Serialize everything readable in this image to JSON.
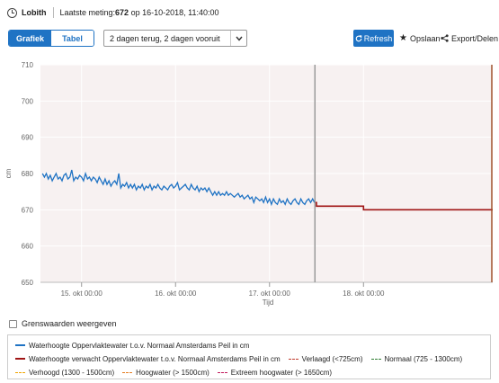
{
  "header": {
    "station": "Lobith",
    "meting_label": "Laatste meting:",
    "meting_value": "672",
    "meting_suffix": " op 16-10-2018, 11:40:00"
  },
  "toolbar": {
    "tab_grafiek": "Grafiek",
    "tab_tabel": "Tabel",
    "range_select": "2 dagen terug, 2 dagen vooruit",
    "refresh": "Refresh",
    "save": "Opslaan",
    "export": "Export/Delen"
  },
  "colors": {
    "accent": "#1f73c4",
    "measured": "#1f73c4",
    "forecast": "#a01515",
    "plot_bg": "#f7f1f1",
    "now_line": "#999999"
  },
  "chart_data": {
    "type": "line",
    "xlabel": "Tijd",
    "ylabel": "cm",
    "ylim": [
      650,
      710
    ],
    "yticks": [
      650,
      660,
      670,
      680,
      690,
      700,
      710
    ],
    "xticks": [
      "15. okt 00:00",
      "16. okt 00:00",
      "17. okt 00:00",
      "18. okt 00:00"
    ],
    "x_range_hours": [
      -10.5,
      105
    ],
    "now_hours": 59.6,
    "series": [
      {
        "name": "Waterhoogte Oppervlaktewater t.o.v. Normaal Amsterdams Peil in cm",
        "color": "#1f73c4",
        "x": [
          -10,
          -9.5,
          -9,
          -8.5,
          -8,
          -7.5,
          -7,
          -6.5,
          -6,
          -5.5,
          -5,
          -4.5,
          -4,
          -3.5,
          -3,
          -2.5,
          -2,
          -1.5,
          -1,
          -0.5,
          0,
          0.5,
          1,
          1.5,
          2,
          2.5,
          3,
          3.5,
          4,
          4.5,
          5,
          5.5,
          6,
          6.5,
          7,
          7.5,
          8,
          8.5,
          9,
          9.5,
          10,
          10.5,
          11,
          11.5,
          12,
          12.5,
          13,
          13.5,
          14,
          14.5,
          15,
          15.5,
          16,
          16.5,
          17,
          17.5,
          18,
          18.5,
          19,
          19.5,
          20,
          20.5,
          21,
          21.5,
          22,
          22.5,
          23,
          23.5,
          24,
          24.5,
          25,
          25.5,
          26,
          26.5,
          27,
          27.5,
          28,
          28.5,
          29,
          29.5,
          30,
          30.5,
          31,
          31.5,
          32,
          32.5,
          33,
          33.5,
          34,
          34.5,
          35,
          35.5,
          36,
          36.5,
          37,
          37.5,
          38,
          38.5,
          39,
          39.5,
          40,
          40.5,
          41,
          41.5,
          42,
          42.5,
          43,
          43.5,
          44,
          44.5,
          45,
          45.5,
          46,
          46.5,
          47,
          47.5,
          48,
          48.5,
          49,
          49.5,
          50,
          50.5,
          51,
          51.5,
          52,
          52.5,
          53,
          53.5,
          54,
          54.5,
          55,
          55.5,
          56,
          56.5,
          57,
          57.5,
          58,
          58.5,
          59,
          59.5
        ],
        "values": [
          680,
          679,
          680,
          678.5,
          679.5,
          678,
          679,
          680,
          678.5,
          679,
          678,
          679.5,
          680,
          678.5,
          679,
          681,
          678,
          679,
          678.5,
          679.5,
          679,
          678,
          680,
          678.5,
          679,
          678,
          679,
          678.5,
          677.5,
          679,
          678,
          677,
          678.5,
          677,
          678,
          676.5,
          677.5,
          678,
          677,
          680,
          676,
          677,
          676.5,
          677.5,
          676,
          677,
          676,
          677,
          675.5,
          676.5,
          676,
          677,
          675.5,
          676.5,
          676,
          677,
          675.5,
          676.5,
          676,
          677,
          676,
          675.5,
          676.5,
          676,
          675.5,
          676.5,
          677,
          676,
          676.5,
          677.5,
          675.5,
          676,
          676.5,
          677,
          676,
          675.5,
          677,
          676,
          675.5,
          676.5,
          675,
          676,
          675.5,
          676,
          675,
          676,
          675,
          674,
          675,
          674,
          675,
          674,
          674.5,
          674,
          675,
          674,
          674.5,
          674,
          673.5,
          674,
          674.5,
          673.5,
          674,
          673,
          673.5,
          674,
          673,
          673.5,
          672,
          673.5,
          673,
          672.5,
          673,
          672,
          673.5,
          672,
          673,
          671.5,
          673,
          672,
          671.5,
          673,
          672,
          672.5,
          671.5,
          673,
          672,
          671.5,
          672.5,
          673,
          672,
          671.5,
          673,
          672,
          671.5,
          672.5,
          673,
          672,
          673,
          672
        ]
      },
      {
        "name": "Waterhoogte verwacht Oppervlaktewater t.o.v. Normaal Amsterdams Peil in cm",
        "color": "#a01515",
        "x": [
          59.6,
          60,
          60,
          66,
          66,
          72,
          72,
          105
        ],
        "values": [
          672,
          672,
          671,
          671,
          671,
          671,
          670,
          670
        ]
      }
    ]
  },
  "threshold_checkbox": {
    "label": "Grenswaarden weergeven",
    "checked": false
  },
  "legend": [
    {
      "label": "Waterhoogte Oppervlaktewater t.o.v. Normaal Amsterdams Peil in cm",
      "color": "#1f73c4",
      "style": "solid"
    },
    {
      "label": "Waterhoogte verwacht Oppervlaktewater t.o.v. Normaal Amsterdams Peil in cm",
      "color": "#a01515",
      "style": "solid"
    },
    {
      "label": "Verlaagd (<725cm)",
      "color": "#c0392b",
      "style": "dashed"
    },
    {
      "label": "Normaal (725 - 1300cm)",
      "color": "#2e7d32",
      "style": "dashed"
    },
    {
      "label": "Verhoogd (1300 - 1500cm)",
      "color": "#f0a500",
      "style": "dashed"
    },
    {
      "label": "Hoogwater (> 1500cm)",
      "color": "#e67e22",
      "style": "dashed"
    },
    {
      "label": "Extreem hoogwater (> 1650cm)",
      "color": "#c2185b",
      "style": "dashed"
    }
  ]
}
